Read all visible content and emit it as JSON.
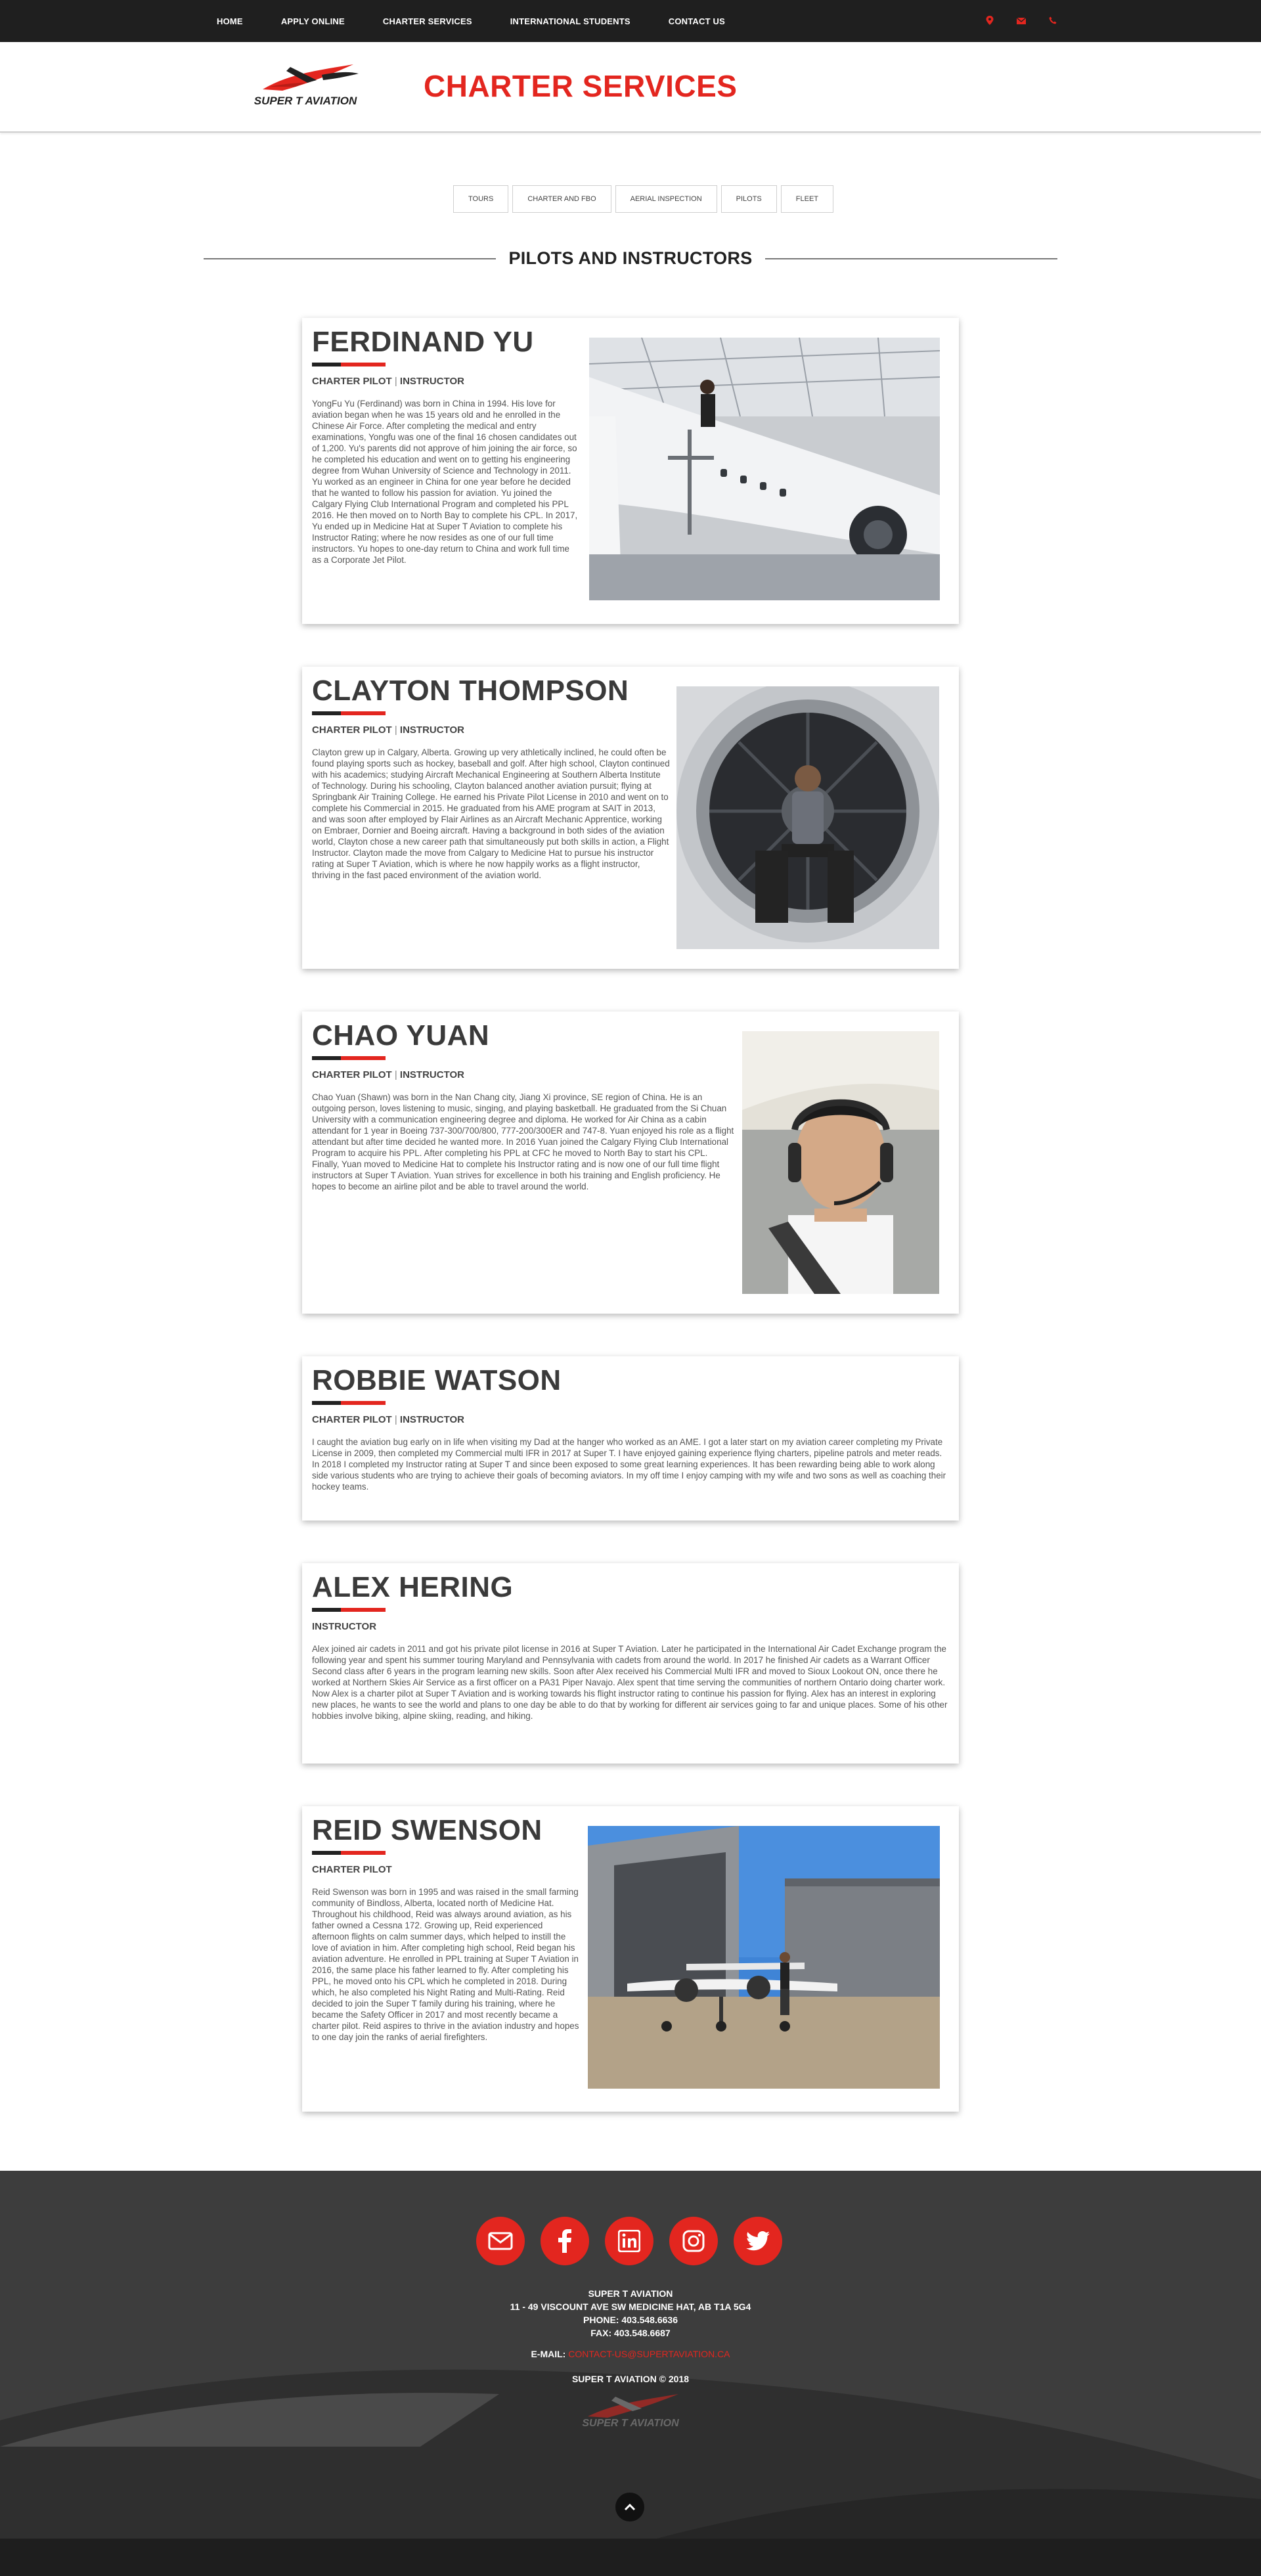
{
  "nav": {
    "items": [
      "HOME",
      "APPLY ONLINE",
      "CHARTER SERVICES",
      "INTERNATIONAL STUDENTS",
      "CONTACT US"
    ],
    "icons": [
      "map-pin-icon",
      "envelope-icon",
      "phone-icon"
    ]
  },
  "header": {
    "logo_text": "SUPER T AVIATION",
    "title": "CHARTER SERVICES"
  },
  "tabs": [
    "TOURS",
    "CHARTER AND FBO",
    "AERIAL INSPECTION",
    "PILOTS",
    "FLEET"
  ],
  "section_title": "PILOTS AND INSTRUCTORS",
  "pilots": [
    {
      "name": "FERDINAND YU",
      "role_a": "CHARTER PILOT",
      "role_sep": "|",
      "role_b": "INSTRUCTOR",
      "bio": "YongFu Yu (Ferdinand) was born in China in 1994. His love for aviation began when he was 15 years old and he enrolled in the Chinese Air Force. After completing the medical and entry examinations, Yongfu was one of the final 16 chosen candidates out of 1,200. Yu's parents did not approve of him joining the air force, so he completed his education and went on to getting his engineering degree from Wuhan University of Science and Technology in 2011. Yu worked as an engineer in China for one year before he decided that he wanted to follow his passion for aviation. Yu joined the Calgary Flying Club International Program and completed his PPL 2016. He then moved on to North Bay to complete his CPL. In 2017, Yu ended up in Medicine Hat at Super T Aviation to complete his Instructor Rating; where he now resides as one of our full time instructors. Yu hopes to one-day return to China and work full time as a Corporate Jet Pilot."
    },
    {
      "name": "CLAYTON THOMPSON",
      "role_a": "CHARTER PILOT",
      "role_sep": "|",
      "role_b": "INSTRUCTOR",
      "bio": "Clayton grew up in Calgary, Alberta. Growing up very athletically inclined, he could often be found playing sports such as hockey, baseball and golf. After high school, Clayton continued with his academics; studying Aircraft Mechanical Engineering at Southern Alberta Institute of Technology. During his schooling, Clayton balanced another aviation pursuit; flying at Springbank Air Training College. He earned his Private Pilot License in 2010 and went on to complete his Commercial in 2015. He graduated from his AME program at SAIT in 2013, and was soon after employed by Flair Airlines as an Aircraft Mechanic Apprentice, working on Embraer, Dornier and Boeing aircraft. Having a background in both sides of the aviation world, Clayton chose a new career path that simultaneously put both skills in action, a Flight Instructor. Clayton made the move from Calgary to Medicine Hat to pursue his instructor rating at Super T Aviation, which is where he now happily works as a flight instructor, thriving in the fast paced environment of the aviation world."
    },
    {
      "name": "CHAO YUAN",
      "role_a": "CHARTER PILOT",
      "role_sep": "|",
      "role_b": "INSTRUCTOR",
      "bio": "Chao Yuan (Shawn) was born in the Nan Chang city, Jiang Xi province, SE region of China. He is an outgoing person, loves listening to music, singing, and playing basketball. He graduated from the Si Chuan University with a communication engineering degree and diploma. He worked for Air China as a cabin attendant for 1 year in Boeing 737-300/700/800, 777-200/300ER and 747-8. Yuan enjoyed his role as a flight attendant but after time decided he wanted more. In 2016 Yuan joined the Calgary Flying Club International Program to acquire his PPL. After completing his PPL at CFC he moved to North Bay to start his CPL. Finally, Yuan moved to Medicine Hat to complete his Instructor rating and is now one of our full time flight instructors at Super T Aviation. Yuan strives for excellence in both his training and English proficiency. He hopes to become an airline pilot and be able to travel around the world."
    },
    {
      "name": "ROBBIE WATSON",
      "role_a": "CHARTER PILOT",
      "role_sep": "|",
      "role_b": "INSTRUCTOR",
      "bio": "I caught the aviation bug early on in life when visiting my Dad at the hanger who worked as an AME. I got a later start on my aviation career completing my Private License in 2009, then completed my Commercial multi IFR in 2017 at Super T. I have enjoyed gaining experience flying charters, pipeline patrols and meter reads. In 2018 I completed my Instructor rating at Super T and since been exposed to some great learning experiences. It has been rewarding being able to work along side various students who are trying to achieve their goals of becoming aviators. In my off time I enjoy camping with my wife and two sons as well as coaching their hockey teams."
    },
    {
      "name": "ALEX HERING",
      "role_a": "INSTRUCTOR",
      "role_sep": "",
      "role_b": "",
      "bio": "Alex joined air cadets in 2011 and got his private pilot license in 2016 at Super T Aviation. Later he participated in the International Air Cadet Exchange program the following year and spent his summer touring Maryland and Pennsylvania with cadets from around the world. In 2017 he finished Air cadets as a Warrant Officer Second class after 6 years in the program learning new skills. Soon after Alex received his Commercial Multi IFR and moved to Sioux Lookout ON, once there he worked at Northern Skies Air Service as a first officer on a PA31 Piper Navajo. Alex spent that time serving the communities of northern Ontario doing charter work. Now Alex is a charter pilot at Super T Aviation and is working towards his flight instructor rating to continue his passion for flying. Alex has an interest in exploring new places, he wants to see the world and plans to one day be able to do that by working for different air services going to far and unique places. Some of his other hobbies involve biking, alpine skiing, reading, and hiking."
    },
    {
      "name": "REID SWENSON",
      "role_a": "CHARTER PILOT",
      "role_sep": "",
      "role_b": "",
      "bio": "Reid Swenson was born in 1995 and was raised in the small farming community of Bindloss, Alberta, located north of Medicine Hat. Throughout his childhood, Reid was always around aviation, as his father owned a Cessna 172. Growing up, Reid experienced afternoon flights on calm summer days, which helped to instill the love of aviation in him. After completing high school, Reid began his aviation adventure. He enrolled in PPL training at Super T Aviation in 2016, the same place his father learned to fly. After completing his PPL, he moved onto his CPL which he completed in 2018. During which, he also completed his Night Rating and Multi-Rating. Reid decided to join the Super T family during his training, where he became the Safety Officer in 2017 and most recently became a charter pilot. Reid aspires to thrive in the aviation industry and hopes to one day join the ranks of aerial firefighters."
    }
  ],
  "footer": {
    "social_icons": [
      "envelope-icon",
      "facebook-icon",
      "linkedin-icon",
      "instagram-icon",
      "twitter-icon"
    ],
    "company": "SUPER T AVIATION",
    "address": "11 - 49 VISCOUNT AVE SW MEDICINE HAT, AB T1A 5G4",
    "phone": "PHONE: 403.548.6636",
    "fax": "FAX: 403.548.6687",
    "email_label": "E-MAIL:",
    "email": "CONTACT-US@SUPERTAVIATION.CA",
    "copyright": "SUPER T AVIATION © 2018",
    "logo_text": "SUPER T AVIATION"
  },
  "colors": {
    "accent": "#e3261f",
    "nav_bg": "#1f1f1f",
    "text": "#444444"
  }
}
